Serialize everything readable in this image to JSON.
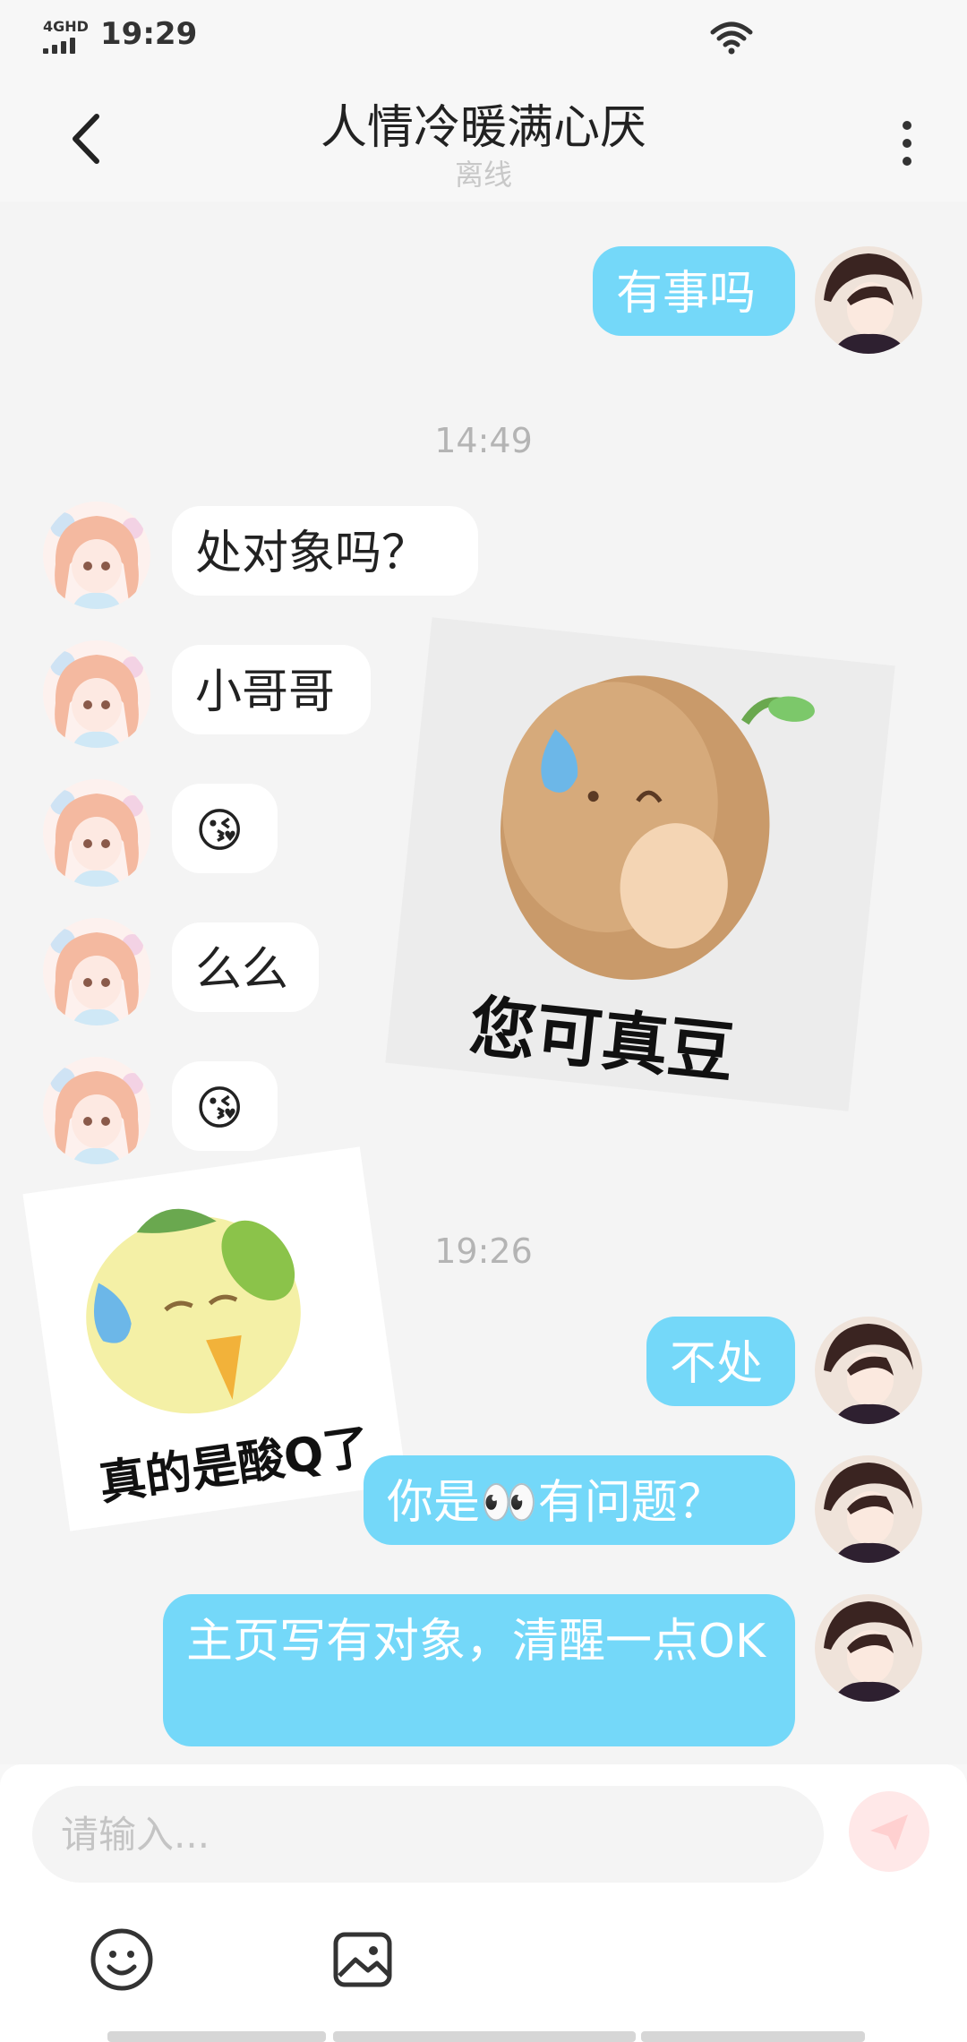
{
  "status_bar": {
    "network": "4GHD",
    "time": "19:29"
  },
  "header": {
    "title": "人情冷暖满心厌",
    "subtitle": "离线"
  },
  "messages": {
    "m1": "有事吗",
    "ts1": "14:49",
    "m2": "处对象吗？",
    "m3": "小哥哥",
    "m4": "😘",
    "m5": "么么",
    "m6": "😘",
    "ts2": "19:26",
    "m7": "不处",
    "m8": "你是👀有问题？",
    "m9": "主页写有对象，清醒一点OK"
  },
  "stickers": {
    "potato": "您可真豆",
    "lemon": "真的是酸Q了"
  },
  "input": {
    "placeholder": "请输入..."
  },
  "icons": {
    "back": "chevron-left-icon",
    "more": "more-vertical-icon",
    "send": "send-icon",
    "emoji": "smiley-icon",
    "image": "image-icon"
  },
  "colors": {
    "outgoing_bubble": "#74d8f9",
    "incoming_bubble": "#ffffff",
    "background": "#f4f4f4",
    "send_button": "#ffe8e8"
  }
}
